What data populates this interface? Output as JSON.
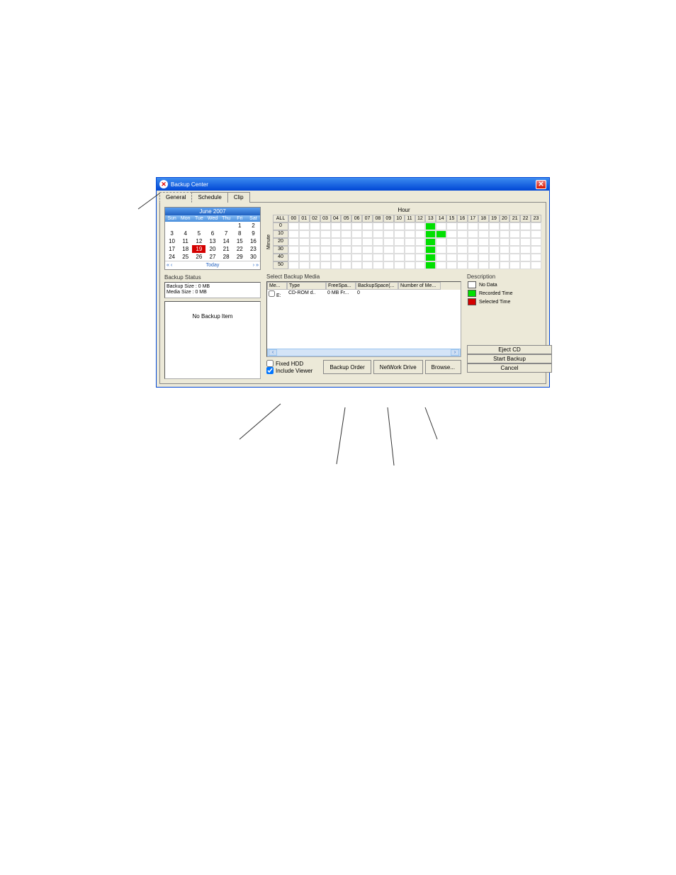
{
  "window": {
    "title": "Backup Center"
  },
  "tabs": {
    "general": "General",
    "schedule": "Schedule",
    "clip": "Clip"
  },
  "calendar": {
    "month": "June 2007",
    "days": [
      "Sun",
      "Mon",
      "Tue",
      "Wed",
      "Thu",
      "Fri",
      "Sat"
    ],
    "blanks": 5,
    "last_day": 30,
    "today": 19,
    "today_label": "Today",
    "nav_first": "«",
    "nav_prev": "‹",
    "nav_next": "›",
    "nav_last": "»"
  },
  "backup_status": {
    "label": "Backup Status",
    "line1": "Backup Size : 0 MB",
    "line2": "Media Size : 0 MB",
    "no_item": "No Backup Item"
  },
  "hour": {
    "title": "Hour",
    "minute": "Minute",
    "all": "ALL",
    "hours": [
      "00",
      "01",
      "02",
      "03",
      "04",
      "05",
      "06",
      "07",
      "08",
      "09",
      "10",
      "11",
      "12",
      "13",
      "14",
      "15",
      "16",
      "17",
      "18",
      "19",
      "20",
      "21",
      "22",
      "23"
    ],
    "rows": [
      "0",
      "10",
      "20",
      "30",
      "40",
      "50"
    ],
    "recorded_cells": [
      [
        0,
        13
      ],
      [
        1,
        13
      ],
      [
        1,
        14
      ],
      [
        2,
        13
      ],
      [
        3,
        13
      ],
      [
        4,
        13
      ],
      [
        5,
        13
      ]
    ]
  },
  "media": {
    "label": "Select Backup Media",
    "headers": [
      "Me...",
      "Type",
      "FreeSpa...",
      "BackupSpace(...",
      "Number of Me..."
    ],
    "rows": [
      {
        "drive": "E:",
        "type": "CD-ROM d..",
        "free": "0 MB Fr...",
        "backup": "0",
        "num": ""
      }
    ]
  },
  "description": {
    "label": "Description",
    "no_data": "No Data",
    "recorded": "Recorded Time",
    "selected": "Selected Time",
    "no_data_color": "#ffffff",
    "recorded_color": "#00e000",
    "selected_color": "#d40000"
  },
  "checks": {
    "fixed_hdd": "Fixed HDD",
    "include_viewer": "Include Viewer"
  },
  "buttons": {
    "backup_order": "Backup Order",
    "network_drive": "NetWork Drive",
    "browse": "Browse...",
    "eject_cd": "Eject CD",
    "start_backup": "Start Backup",
    "cancel": "Cancel"
  }
}
